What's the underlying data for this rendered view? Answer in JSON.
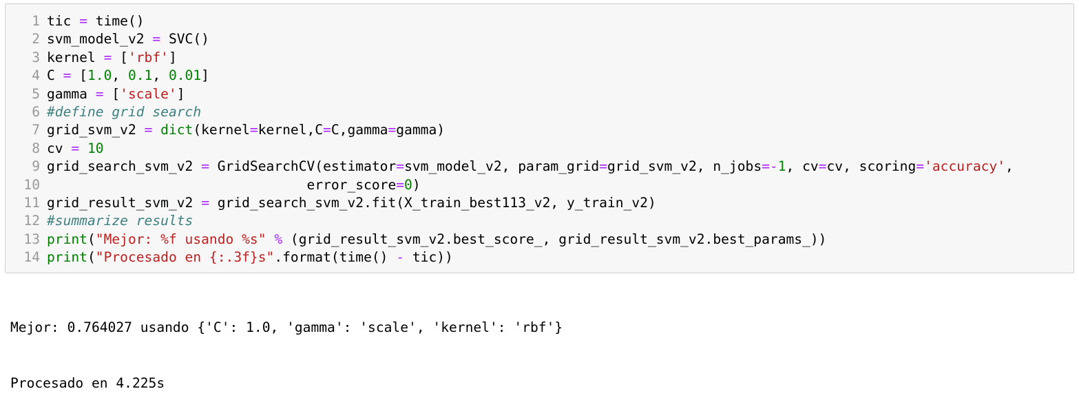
{
  "code_cell": {
    "lines": [
      {
        "n": "1",
        "tokens": [
          [
            "var",
            "tic "
          ],
          [
            "op",
            "="
          ],
          [
            "var",
            " time()"
          ]
        ]
      },
      {
        "n": "2",
        "tokens": [
          [
            "var",
            "svm_model_v2 "
          ],
          [
            "op",
            "="
          ],
          [
            "var",
            " SVC()"
          ]
        ]
      },
      {
        "n": "3",
        "tokens": [
          [
            "var",
            "kernel "
          ],
          [
            "op",
            "="
          ],
          [
            "var",
            " ["
          ],
          [
            "str",
            "'rbf'"
          ],
          [
            "var",
            "]"
          ]
        ]
      },
      {
        "n": "4",
        "tokens": [
          [
            "var",
            "C "
          ],
          [
            "op",
            "="
          ],
          [
            "var",
            " ["
          ],
          [
            "num",
            "1.0"
          ],
          [
            "var",
            ", "
          ],
          [
            "num",
            "0.1"
          ],
          [
            "var",
            ", "
          ],
          [
            "num",
            "0.01"
          ],
          [
            "var",
            "]"
          ]
        ]
      },
      {
        "n": "5",
        "tokens": [
          [
            "var",
            "gamma "
          ],
          [
            "op",
            "="
          ],
          [
            "var",
            " ["
          ],
          [
            "str",
            "'scale'"
          ],
          [
            "var",
            "]"
          ]
        ]
      },
      {
        "n": "6",
        "tokens": [
          [
            "com",
            "#define grid search"
          ]
        ]
      },
      {
        "n": "7",
        "tokens": [
          [
            "var",
            "grid_svm_v2 "
          ],
          [
            "op",
            "="
          ],
          [
            "var",
            " "
          ],
          [
            "kw",
            "dict"
          ],
          [
            "var",
            "(kernel"
          ],
          [
            "op",
            "="
          ],
          [
            "var",
            "kernel,C"
          ],
          [
            "op",
            "="
          ],
          [
            "var",
            "C,gamma"
          ],
          [
            "op",
            "="
          ],
          [
            "var",
            "gamma)"
          ]
        ]
      },
      {
        "n": "8",
        "tokens": [
          [
            "var",
            "cv "
          ],
          [
            "op",
            "="
          ],
          [
            "var",
            " "
          ],
          [
            "num",
            "10"
          ]
        ]
      },
      {
        "n": "9",
        "tokens": [
          [
            "var",
            "grid_search_svm_v2 "
          ],
          [
            "op",
            "="
          ],
          [
            "var",
            " GridSearchCV(estimator"
          ],
          [
            "op",
            "="
          ],
          [
            "var",
            "svm_model_v2, param_grid"
          ],
          [
            "op",
            "="
          ],
          [
            "var",
            "grid_svm_v2, n_jobs"
          ],
          [
            "op",
            "=-"
          ],
          [
            "num",
            "1"
          ],
          [
            "var",
            ", cv"
          ],
          [
            "op",
            "="
          ],
          [
            "var",
            "cv, scoring"
          ],
          [
            "op",
            "="
          ],
          [
            "str",
            "'accuracy'"
          ],
          [
            "var",
            ","
          ]
        ]
      },
      {
        "n": "10",
        "tokens": [
          [
            "var",
            "                                error_score"
          ],
          [
            "op",
            "="
          ],
          [
            "num",
            "0"
          ],
          [
            "var",
            ")"
          ]
        ]
      },
      {
        "n": "11",
        "tokens": [
          [
            "var",
            "grid_result_svm_v2 "
          ],
          [
            "op",
            "="
          ],
          [
            "var",
            " grid_search_svm_v2.fit(X_train_best113_v2, y_train_v2)"
          ]
        ]
      },
      {
        "n": "12",
        "tokens": [
          [
            "com",
            "#summarize results"
          ]
        ]
      },
      {
        "n": "13",
        "tokens": [
          [
            "kw",
            "print"
          ],
          [
            "var",
            "("
          ],
          [
            "str",
            "\"Mejor: %f usando %s\""
          ],
          [
            "var",
            " "
          ],
          [
            "op",
            "%"
          ],
          [
            "var",
            " (grid_result_svm_v2.best_score_, grid_result_svm_v2.best_params_))"
          ]
        ]
      },
      {
        "n": "14",
        "tokens": [
          [
            "kw",
            "print"
          ],
          [
            "var",
            "("
          ],
          [
            "str",
            "\"Procesado en {:.3f}s\""
          ],
          [
            "var",
            ".format(time() "
          ],
          [
            "op",
            "-"
          ],
          [
            "var",
            " tic))"
          ]
        ]
      }
    ]
  },
  "output": {
    "line1": "Mejor: 0.764027 usando {'C': 1.0, 'gamma': 'scale', 'kernel': 'rbf'}",
    "line2": "Procesado en 4.225s"
  }
}
